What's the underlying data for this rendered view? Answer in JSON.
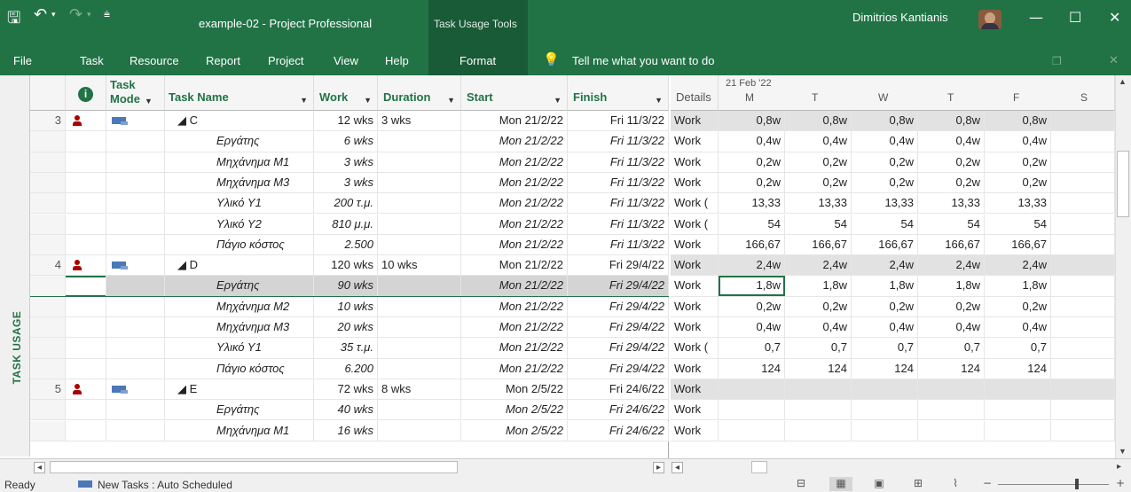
{
  "titlebar": {
    "file_title": "example-02  -  Project Professional",
    "contextual_tab": "Task Usage Tools",
    "user_name": "Dimitrios Kantianis"
  },
  "menu": {
    "items": [
      "File",
      "Task",
      "Resource",
      "Report",
      "Project",
      "View",
      "Help",
      "Format"
    ],
    "tell_me": "Tell me what you want to do"
  },
  "view_label": "TASK USAGE",
  "columns": {
    "info": "i",
    "task_mode_1": "Task",
    "task_mode_2": "Mode",
    "task_name": "Task Name",
    "work": "Work",
    "duration": "Duration",
    "start": "Start",
    "finish": "Finish"
  },
  "timescale": {
    "details": "Details",
    "week": "21 Feb '22",
    "days": [
      "M",
      "T",
      "W",
      "T",
      "F",
      "S"
    ]
  },
  "rows": [
    {
      "id": "3",
      "task": true,
      "name": "◢ C",
      "work": "12 wks",
      "duration": "3 wks",
      "start": "Mon 21/2/22",
      "finish": "Fri 11/3/22",
      "detail": "Work",
      "vals": [
        "0,8w",
        "0,8w",
        "0,8w",
        "0,8w",
        "0,8w"
      ]
    },
    {
      "id": "",
      "task": false,
      "name": "Εργάτης",
      "work": "6 wks",
      "duration": "",
      "start": "Mon 21/2/22",
      "finish": "Fri 11/3/22",
      "detail": "Work",
      "vals": [
        "0,4w",
        "0,4w",
        "0,4w",
        "0,4w",
        "0,4w"
      ]
    },
    {
      "id": "",
      "task": false,
      "name": "Μηχάνημα Μ1",
      "work": "3 wks",
      "duration": "",
      "start": "Mon 21/2/22",
      "finish": "Fri 11/3/22",
      "detail": "Work",
      "vals": [
        "0,2w",
        "0,2w",
        "0,2w",
        "0,2w",
        "0,2w"
      ]
    },
    {
      "id": "",
      "task": false,
      "name": "Μηχάνημα Μ3",
      "work": "3 wks",
      "duration": "",
      "start": "Mon 21/2/22",
      "finish": "Fri 11/3/22",
      "detail": "Work",
      "vals": [
        "0,2w",
        "0,2w",
        "0,2w",
        "0,2w",
        "0,2w"
      ]
    },
    {
      "id": "",
      "task": false,
      "name": "Υλικό Υ1",
      "work": "200 τ.μ.",
      "duration": "",
      "start": "Mon 21/2/22",
      "finish": "Fri 11/3/22",
      "detail": "Work (",
      "vals": [
        "13,33",
        "13,33",
        "13,33",
        "13,33",
        "13,33"
      ]
    },
    {
      "id": "",
      "task": false,
      "name": "Υλικό Υ2",
      "work": "810 μ.μ.",
      "duration": "",
      "start": "Mon 21/2/22",
      "finish": "Fri 11/3/22",
      "detail": "Work (",
      "vals": [
        "54",
        "54",
        "54",
        "54",
        "54"
      ]
    },
    {
      "id": "",
      "task": false,
      "name": "Πάγιο κόστος",
      "work": "2.500",
      "duration": "",
      "start": "Mon 21/2/22",
      "finish": "Fri 11/3/22",
      "detail": "Work",
      "vals": [
        "166,67",
        "166,67",
        "166,67",
        "166,67",
        "166,67"
      ]
    },
    {
      "id": "4",
      "task": true,
      "name": "◢ D",
      "work": "120 wks",
      "duration": "10 wks",
      "start": "Mon 21/2/22",
      "finish": "Fri 29/4/22",
      "detail": "Work",
      "vals": [
        "2,4w",
        "2,4w",
        "2,4w",
        "2,4w",
        "2,4w"
      ]
    },
    {
      "id": "",
      "task": false,
      "selected": true,
      "name": "Εργάτης",
      "work": "90 wks",
      "duration": "",
      "start": "Mon 21/2/22",
      "finish": "Fri 29/4/22",
      "detail": "Work",
      "vals": [
        "1,8w",
        "1,8w",
        "1,8w",
        "1,8w",
        "1,8w"
      ]
    },
    {
      "id": "",
      "task": false,
      "name": "Μηχάνημα Μ2",
      "work": "10 wks",
      "duration": "",
      "start": "Mon 21/2/22",
      "finish": "Fri 29/4/22",
      "detail": "Work",
      "vals": [
        "0,2w",
        "0,2w",
        "0,2w",
        "0,2w",
        "0,2w"
      ]
    },
    {
      "id": "",
      "task": false,
      "name": "Μηχάνημα Μ3",
      "work": "20 wks",
      "duration": "",
      "start": "Mon 21/2/22",
      "finish": "Fri 29/4/22",
      "detail": "Work",
      "vals": [
        "0,4w",
        "0,4w",
        "0,4w",
        "0,4w",
        "0,4w"
      ]
    },
    {
      "id": "",
      "task": false,
      "name": "Υλικό Υ1",
      "work": "35 τ.μ.",
      "duration": "",
      "start": "Mon 21/2/22",
      "finish": "Fri 29/4/22",
      "detail": "Work (",
      "vals": [
        "0,7",
        "0,7",
        "0,7",
        "0,7",
        "0,7"
      ]
    },
    {
      "id": "",
      "task": false,
      "name": "Πάγιο κόστος",
      "work": "6.200",
      "duration": "",
      "start": "Mon 21/2/22",
      "finish": "Fri 29/4/22",
      "detail": "Work",
      "vals": [
        "124",
        "124",
        "124",
        "124",
        "124"
      ]
    },
    {
      "id": "5",
      "task": true,
      "name": "◢ E",
      "work": "72 wks",
      "duration": "8 wks",
      "start": "Mon 2/5/22",
      "finish": "Fri 24/6/22",
      "detail": "Work",
      "vals": [
        "",
        "",
        "",
        "",
        ""
      ]
    },
    {
      "id": "",
      "task": false,
      "name": "Εργάτης",
      "work": "40 wks",
      "duration": "",
      "start": "Mon 2/5/22",
      "finish": "Fri 24/6/22",
      "detail": "Work",
      "vals": [
        "",
        "",
        "",
        "",
        ""
      ]
    },
    {
      "id": "",
      "task": false,
      "name": "Μηχάνημα Μ1",
      "work": "16 wks",
      "duration": "",
      "start": "Mon 2/5/22",
      "finish": "Fri 24/6/22",
      "detail": "Work",
      "vals": [
        "",
        "",
        "",
        "",
        ""
      ]
    }
  ],
  "status": {
    "ready": "Ready",
    "new_tasks": "New Tasks : Auto Scheduled"
  }
}
